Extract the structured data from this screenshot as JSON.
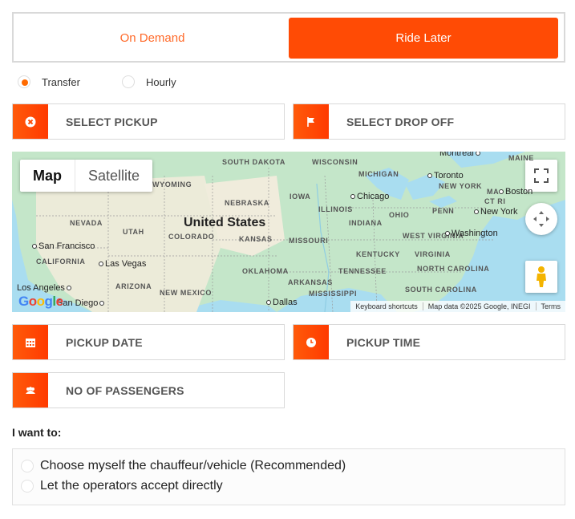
{
  "tabs": {
    "on_demand": "On Demand",
    "ride_later": "Ride Later"
  },
  "trip_type": {
    "transfer": "Transfer",
    "hourly": "Hourly",
    "selected": "Transfer"
  },
  "fields": {
    "pickup": "SELECT PICKUP",
    "dropoff": "SELECT DROP OFF",
    "pickup_date": "PICKUP DATE",
    "pickup_time": "PICKUP TIME",
    "passengers": "NO OF PASSENGERS"
  },
  "map": {
    "type_map": "Map",
    "type_satellite": "Satellite",
    "country": "United States",
    "states": [
      "SOUTH DAKOTA",
      "WYOMING",
      "NEBRASKA",
      "NEVADA",
      "UTAH",
      "COLORADO",
      "KANSAS",
      "CALIFORNIA",
      "ARIZONA",
      "NEW MEXICO",
      "OKLAHOMA",
      "ARKANSAS",
      "MISSISSIPPI",
      "TENNESSEE",
      "KENTUCKY",
      "WEST VIRGINIA",
      "VIRGINIA",
      "NORTH CAROLINA",
      "SOUTH CAROLINA",
      "MISSOURI",
      "IOWA",
      "ILLINOIS",
      "INDIANA",
      "OHIO",
      "PENN",
      "WISCONSIN",
      "MICHIGAN",
      "NEW YORK",
      "MAINE",
      "CT RI",
      "MA"
    ],
    "cities": [
      "San Francisco",
      "Las Vegas",
      "Los Angeles",
      "San Diego",
      "Chicago",
      "Toronto",
      "Boston",
      "New York",
      "Washington",
      "Dallas",
      "Montreal"
    ],
    "attribution": {
      "shortcuts": "Keyboard shortcuts",
      "data": "Map data ©2025 Google, INEGI",
      "terms": "Terms"
    },
    "logo": "Google"
  },
  "ride_preference": {
    "heading": "I want to:",
    "options": [
      "Choose myself the chauffeur/vehicle (Recommended)",
      "Let the operators accept directly"
    ]
  },
  "colors": {
    "accent": "#ff4b05",
    "accent_text": "#ff6a2a",
    "water": "#a9ddf0",
    "land": "#c4e6c9"
  },
  "icons": {
    "pickup": "times-circle-icon",
    "dropoff": "flag-icon",
    "date": "calendar-icon",
    "time": "clock-icon",
    "passengers": "users-icon"
  }
}
